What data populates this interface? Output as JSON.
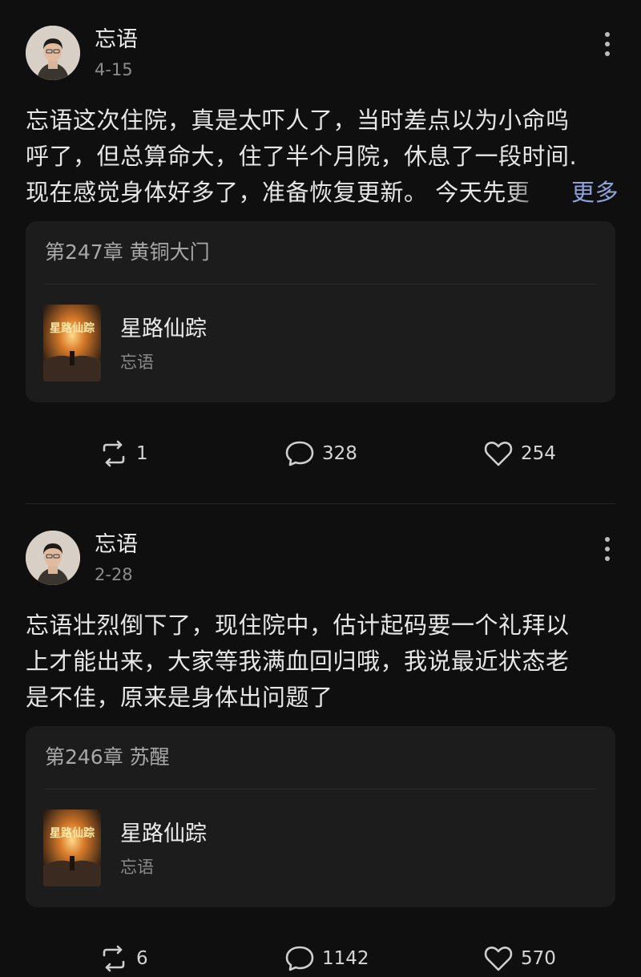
{
  "posts": [
    {
      "author": "忘语",
      "date": "4-15",
      "text_lines": [
        "忘语这次住院，真是太吓人了，当时差点以为小命呜",
        "呼了，但总算命大，住了半个月院，休息了一段时间.",
        "现在感觉身体好多了，准备恢复更新。 今天先更"
      ],
      "more_label": "更多",
      "chapter": "第247章 黄铜大门",
      "book_title": "星路仙踪",
      "book_author": "忘语",
      "reposts": "1",
      "comments": "328",
      "likes": "254"
    },
    {
      "author": "忘语",
      "date": "2-28",
      "text_lines": [
        "忘语壮烈倒下了，现住院中，估计起码要一个礼拜以",
        "上才能出来，大家等我满血回归哦，我说最近状态老",
        "是不佳，原来是身体出问题了"
      ],
      "chapter": "第246章 苏醒",
      "book_title": "星路仙踪",
      "book_author": "忘语",
      "reposts": "6",
      "comments": "1142",
      "likes": "570"
    }
  ],
  "icons": {
    "more": "more-vertical-icon",
    "repost": "repost-icon",
    "comment": "comment-icon",
    "like": "heart-icon"
  },
  "colors": {
    "background": "#0f0f0f",
    "card": "#1c1c1c",
    "more_link": "#8fa3d8"
  }
}
